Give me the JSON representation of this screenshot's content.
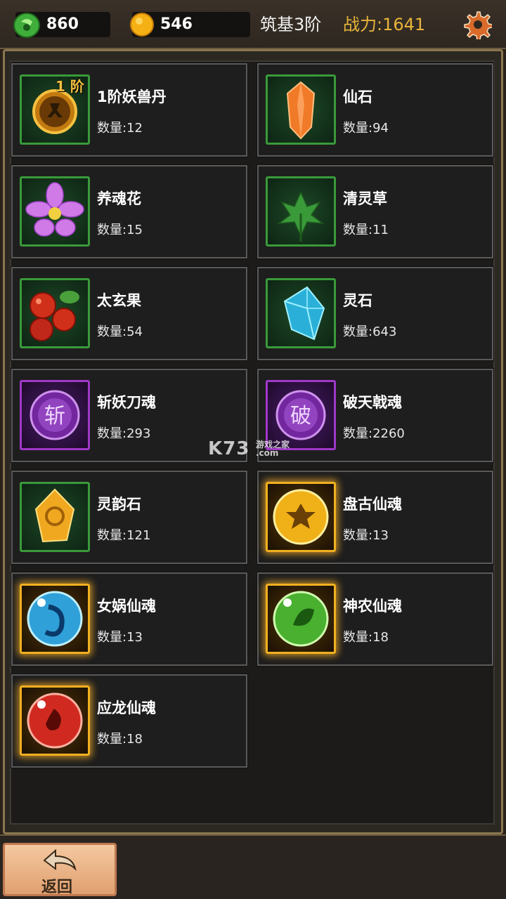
{
  "header": {
    "jade_count": "860",
    "gold_count": "546",
    "realm": "筑基3阶",
    "power_label": "战力:1641"
  },
  "items": [
    {
      "name": "1阶妖兽丹",
      "qty": "数量:12",
      "icon": "beast-pill-icon",
      "badge": "1 阶",
      "frame": "green"
    },
    {
      "name": "仙石",
      "qty": "数量:94",
      "icon": "orange-crystal-icon",
      "frame": "green"
    },
    {
      "name": "养魂花",
      "qty": "数量:15",
      "icon": "purple-flower-icon",
      "frame": "green"
    },
    {
      "name": "清灵草",
      "qty": "数量:11",
      "icon": "herb-leaf-icon",
      "frame": "green"
    },
    {
      "name": "太玄果",
      "qty": "数量:54",
      "icon": "red-berries-icon",
      "frame": "green"
    },
    {
      "name": "灵石",
      "qty": "数量:643",
      "icon": "blue-crystal-icon",
      "frame": "green"
    },
    {
      "name": "斩妖刀魂",
      "qty": "数量:293",
      "icon": "slash-rune-orb-icon",
      "rune": "斩",
      "frame": "purple"
    },
    {
      "name": "破天戟魂",
      "qty": "数量:2260",
      "icon": "break-rune-orb-icon",
      "rune": "破",
      "frame": "purple"
    },
    {
      "name": "灵韵石",
      "qty": "数量:121",
      "icon": "golden-rune-stone-icon",
      "frame": "green"
    },
    {
      "name": "盘古仙魂",
      "qty": "数量:13",
      "icon": "gold-gem-icon",
      "frame": "gold"
    },
    {
      "name": "女娲仙魂",
      "qty": "数量:13",
      "icon": "blue-gem-icon",
      "frame": "gold"
    },
    {
      "name": "神农仙魂",
      "qty": "数量:18",
      "icon": "green-gem-icon",
      "frame": "gold"
    },
    {
      "name": "应龙仙魂",
      "qty": "数量:18",
      "icon": "red-gem-icon",
      "frame": "gold"
    }
  ],
  "watermark": {
    "brand": "K73",
    "sub": "游戏之家",
    "domain": ".com"
  },
  "footer": {
    "back_label": "返回"
  },
  "colors": {
    "accent_gold": "#e8b43a",
    "frame_green": "#3a9a3a",
    "frame_purple": "#a038c8",
    "frame_gold": "#f0b020"
  }
}
